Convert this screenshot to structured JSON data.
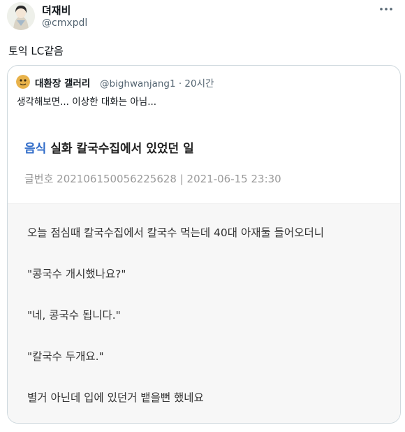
{
  "tweet": {
    "display_name": "뎌재비",
    "handle": "@cmxpdl",
    "text": "토익 LC같음",
    "more_icon": "more-horizontal-icon"
  },
  "quote": {
    "name": "대환장 갤러리",
    "handle_time": "@bighwanjang1 · 20시간",
    "text": "생각해보면... 이상한 대화는 아님...",
    "post": {
      "category": "음식",
      "title": "실화 칼국수집에서 있었던 일",
      "meta": "글번호 20210615005622​5628 | 2021-06-15 23:30",
      "lines": [
        "오늘 점심때 칼국수집에서 칼국수 먹는데 40대 아재둘 들어오더니",
        "\"콩국수 개시했나요?\"",
        "\"네, 콩국수 됩니다.\"",
        "\"칼국수 두개요.\"",
        "별거 아닌데 입에 있던거 뱉을뻔 했네요"
      ]
    }
  }
}
